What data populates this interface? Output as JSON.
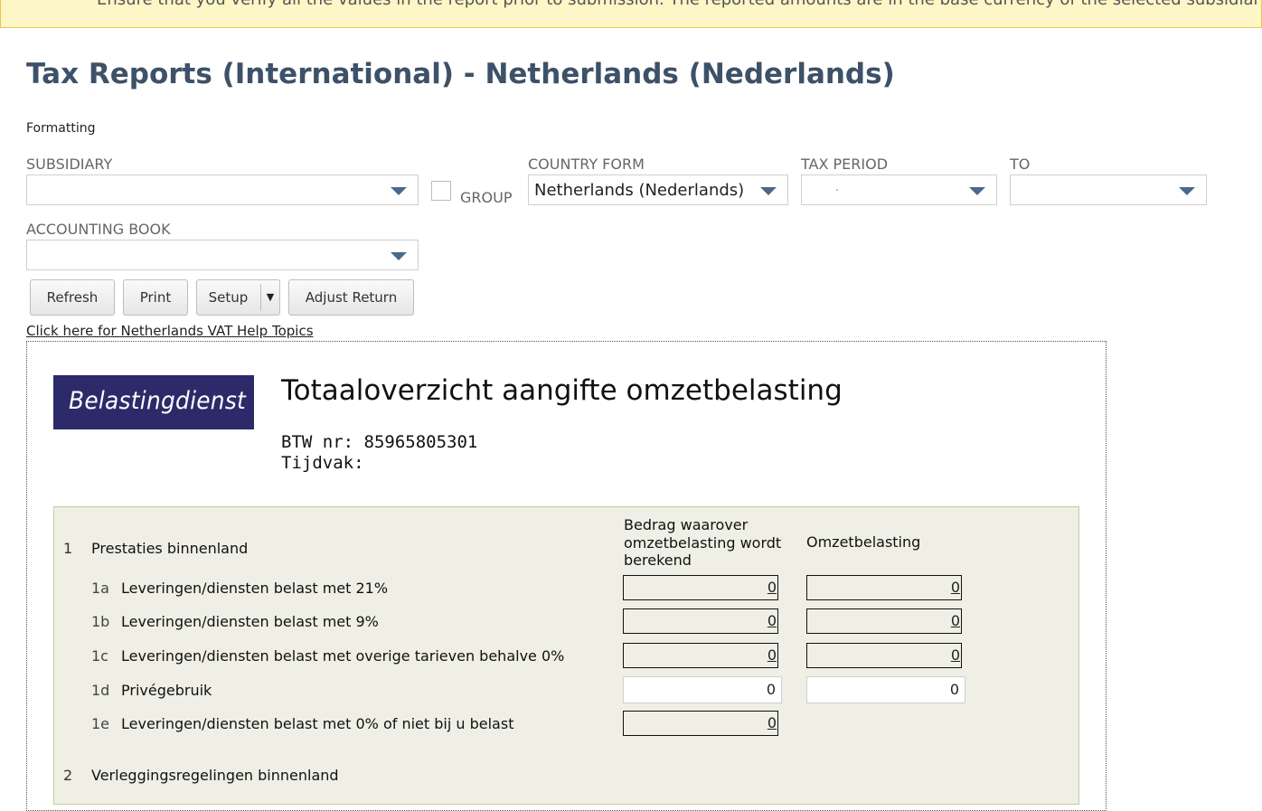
{
  "banner": {
    "text": "Ensure that you verify all the values in the report prior to submission. The reported amounts are in the base currency of the selected subsidiary."
  },
  "page": {
    "title": "Tax Reports (International) - Netherlands (Nederlands)",
    "formatting_label": "Formatting"
  },
  "filters": {
    "subsidiary_label": "SUBSIDIARY",
    "subsidiary_value": "",
    "group_label": "GROUP",
    "country_form_label": "COUNTRY FORM",
    "country_form_value": "Netherlands (Nederlands)",
    "tax_period_label": "TAX PERIOD",
    "tax_period_value": ".",
    "to_label": "TO",
    "to_value": "",
    "accounting_book_label": "ACCOUNTING BOOK",
    "accounting_book_value": ""
  },
  "buttons": {
    "refresh": "Refresh",
    "print": "Print",
    "setup": "Setup",
    "setup_caret": "▼",
    "adjust_return": "Adjust Return"
  },
  "help_link": "Click here for Netherlands VAT Help Topics",
  "report": {
    "logo_text": "Belastingdienst",
    "title": "Totaaloverzicht aangifte omzetbelasting",
    "btw_label": "BTW nr: 85965805301",
    "tijdvak_label": "Tijdvak:",
    "col_amount_header": [
      "Bedrag waarover",
      "omzetbelasting wordt",
      "berekend"
    ],
    "col_tax_header": "Omzetbelasting",
    "section1": {
      "num": "1",
      "label": "Prestaties binnenland"
    },
    "rows": [
      {
        "code": "1a",
        "label": "Leveringen/diensten belast met 21%",
        "amount": "0",
        "tax": "0"
      },
      {
        "code": "1b",
        "label": "Leveringen/diensten belast met 9%",
        "amount": "0",
        "tax": "0"
      },
      {
        "code": "1c",
        "label": "Leveringen/diensten belast met overige tarieven behalve 0%",
        "amount": "0",
        "tax": "0"
      },
      {
        "code": "1d",
        "label": "Privégebruik",
        "amount": "0",
        "tax": "0"
      },
      {
        "code": "1e",
        "label": "Leveringen/diensten belast met 0% of niet bij u belast",
        "amount": "0"
      }
    ],
    "section2": {
      "num": "2",
      "label": "Verleggingsregelingen binnenland"
    }
  }
}
